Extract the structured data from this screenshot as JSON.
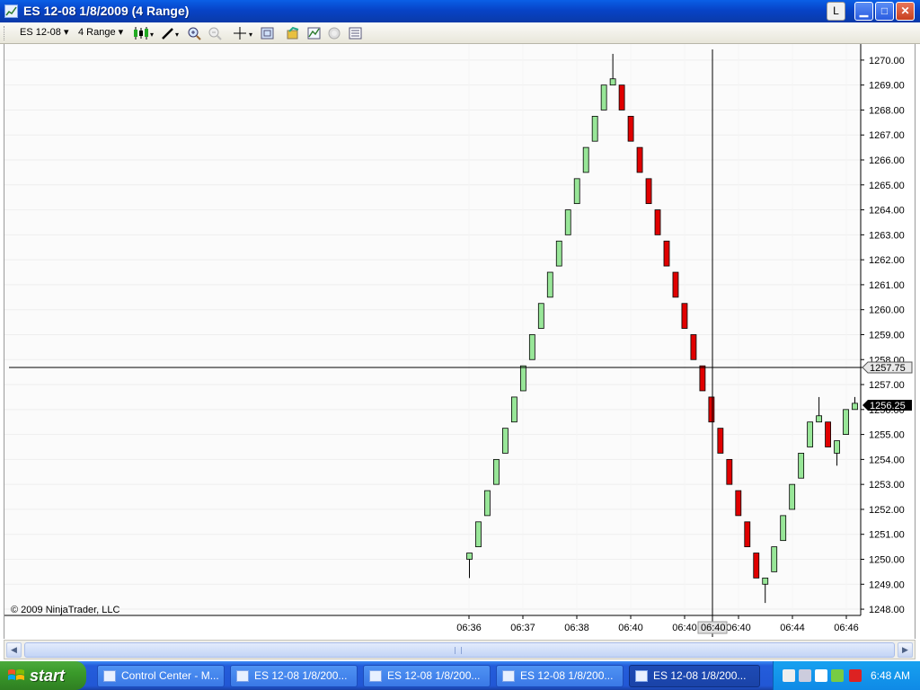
{
  "window": {
    "title": "ES 12-08  1/8/2009 (4 Range)",
    "btn_l": "L"
  },
  "toolbar": {
    "instrument": "ES 12-08",
    "interval": "4 Range",
    "icons": [
      "candlestick-icon",
      "drawing-pencil-icon",
      "zoom-in-icon",
      "zoom-out-icon",
      "crosshair-icon",
      "properties-icon",
      "data-series-icon",
      "indicators-icon",
      "strategies-icon",
      "data-box-icon"
    ]
  },
  "chart": {
    "copyright": "© 2009 NinjaTrader, LLC",
    "cursor_time": "06:40",
    "cursor_price": "1257.75",
    "last_price": "1256.25"
  },
  "chart_data": {
    "type": "candlestick",
    "x_labels": [
      "06:36",
      "06:37",
      "06:38",
      "06:40",
      "06:40",
      "06:40",
      "06:44",
      "06:46"
    ],
    "y_ticks": [
      "1248.00",
      "1249.00",
      "1250.00",
      "1251.00",
      "1252.00",
      "1253.00",
      "1254.00",
      "1255.00",
      "1256.00",
      "1257.00",
      "1258.00",
      "1259.00",
      "1260.00",
      "1261.00",
      "1262.00",
      "1263.00",
      "1264.00",
      "1265.00",
      "1266.00",
      "1267.00",
      "1268.00",
      "1269.00",
      "1270.00"
    ],
    "ylim": [
      1247.75,
      1270.5
    ],
    "up_color": "#98e698",
    "down_color": "#e00000",
    "bars": [
      {
        "o": 1250.0,
        "h": 1250.25,
        "l": 1249.25,
        "c": 1250.25
      },
      {
        "o": 1250.5,
        "h": 1251.5,
        "l": 1250.5,
        "c": 1251.5
      },
      {
        "o": 1251.75,
        "h": 1252.75,
        "l": 1251.75,
        "c": 1252.75
      },
      {
        "o": 1253.0,
        "h": 1254.0,
        "l": 1253.0,
        "c": 1254.0
      },
      {
        "o": 1254.25,
        "h": 1255.25,
        "l": 1254.25,
        "c": 1255.25
      },
      {
        "o": 1255.5,
        "h": 1256.5,
        "l": 1255.5,
        "c": 1256.5
      },
      {
        "o": 1256.75,
        "h": 1257.75,
        "l": 1256.75,
        "c": 1257.75
      },
      {
        "o": 1258.0,
        "h": 1259.0,
        "l": 1258.0,
        "c": 1259.0
      },
      {
        "o": 1259.25,
        "h": 1260.25,
        "l": 1259.25,
        "c": 1260.25
      },
      {
        "o": 1260.5,
        "h": 1261.5,
        "l": 1260.5,
        "c": 1261.5
      },
      {
        "o": 1261.75,
        "h": 1262.75,
        "l": 1261.75,
        "c": 1262.75
      },
      {
        "o": 1263.0,
        "h": 1264.0,
        "l": 1263.0,
        "c": 1264.0
      },
      {
        "o": 1264.25,
        "h": 1265.25,
        "l": 1264.25,
        "c": 1265.25
      },
      {
        "o": 1265.5,
        "h": 1266.5,
        "l": 1265.5,
        "c": 1266.5
      },
      {
        "o": 1266.75,
        "h": 1267.75,
        "l": 1266.75,
        "c": 1267.75
      },
      {
        "o": 1268.0,
        "h": 1269.0,
        "l": 1268.0,
        "c": 1269.0
      },
      {
        "o": 1269.0,
        "h": 1270.25,
        "l": 1269.25,
        "c": 1269.25
      },
      {
        "o": 1269.0,
        "h": 1269.0,
        "l": 1268.0,
        "c": 1268.0
      },
      {
        "o": 1267.75,
        "h": 1267.75,
        "l": 1266.75,
        "c": 1266.75
      },
      {
        "o": 1266.5,
        "h": 1266.5,
        "l": 1265.5,
        "c": 1265.5
      },
      {
        "o": 1265.25,
        "h": 1265.25,
        "l": 1264.25,
        "c": 1264.25
      },
      {
        "o": 1264.0,
        "h": 1264.0,
        "l": 1263.0,
        "c": 1263.0
      },
      {
        "o": 1262.75,
        "h": 1262.75,
        "l": 1261.75,
        "c": 1261.75
      },
      {
        "o": 1261.5,
        "h": 1261.5,
        "l": 1260.5,
        "c": 1260.5
      },
      {
        "o": 1260.25,
        "h": 1260.25,
        "l": 1259.25,
        "c": 1259.25
      },
      {
        "o": 1259.0,
        "h": 1259.0,
        "l": 1258.0,
        "c": 1258.0
      },
      {
        "o": 1257.75,
        "h": 1257.75,
        "l": 1256.75,
        "c": 1256.75
      },
      {
        "o": 1256.5,
        "h": 1256.5,
        "l": 1255.5,
        "c": 1255.5
      },
      {
        "o": 1255.25,
        "h": 1255.25,
        "l": 1254.25,
        "c": 1254.25
      },
      {
        "o": 1254.0,
        "h": 1254.0,
        "l": 1253.0,
        "c": 1253.0
      },
      {
        "o": 1252.75,
        "h": 1252.75,
        "l": 1251.75,
        "c": 1251.75
      },
      {
        "o": 1251.5,
        "h": 1251.5,
        "l": 1250.5,
        "c": 1250.5
      },
      {
        "o": 1250.25,
        "h": 1250.25,
        "l": 1249.25,
        "c": 1249.25
      },
      {
        "o": 1249.0,
        "h": 1249.25,
        "l": 1248.25,
        "c": 1249.25
      },
      {
        "o": 1249.5,
        "h": 1250.5,
        "l": 1249.5,
        "c": 1250.5
      },
      {
        "o": 1250.75,
        "h": 1251.75,
        "l": 1250.75,
        "c": 1251.75
      },
      {
        "o": 1252.0,
        "h": 1253.0,
        "l": 1252.0,
        "c": 1253.0
      },
      {
        "o": 1253.25,
        "h": 1254.25,
        "l": 1253.25,
        "c": 1254.25
      },
      {
        "o": 1254.5,
        "h": 1255.5,
        "l": 1254.5,
        "c": 1255.5
      },
      {
        "o": 1255.5,
        "h": 1256.5,
        "l": 1255.5,
        "c": 1255.75
      },
      {
        "o": 1255.5,
        "h": 1255.5,
        "l": 1254.5,
        "c": 1254.5
      },
      {
        "o": 1254.25,
        "h": 1254.75,
        "l": 1253.75,
        "c": 1254.75
      },
      {
        "o": 1255.0,
        "h": 1256.0,
        "l": 1255.0,
        "c": 1256.0
      },
      {
        "o": 1256.0,
        "h": 1256.5,
        "l": 1256.0,
        "c": 1256.25
      }
    ]
  },
  "taskbar": {
    "start": "start",
    "tasks": [
      "Control Center - M...",
      "ES 12-08  1/8/200...",
      "ES 12-08  1/8/200...",
      "ES 12-08  1/8/200...",
      "ES 12-08  1/8/200..."
    ],
    "clock": "6:48 AM"
  }
}
